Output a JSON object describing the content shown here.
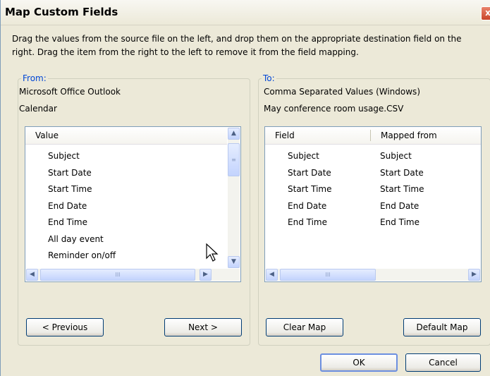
{
  "window": {
    "title": "Map Custom Fields",
    "close_label": "x"
  },
  "instructions": "Drag the values from the source file on the left, and drop them on the appropriate destination field on the right.  Drag the item from the right to the left to remove it from the field mapping.",
  "from": {
    "legend": "From:",
    "source_line1": "Microsoft Office Outlook",
    "source_line2": "Calendar",
    "list_header": "Value",
    "items": [
      "Subject",
      "Start Date",
      "Start Time",
      "End Date",
      "End Time",
      "All day event",
      "Reminder on/off"
    ],
    "previous_label": "< Previous",
    "next_label": "Next >"
  },
  "to": {
    "legend": "To:",
    "dest_line1": "Comma Separated Values (Windows)",
    "dest_line2": "May conference room usage.CSV",
    "col_field": "Field",
    "col_mapped": "Mapped from",
    "rows": [
      {
        "field": "Subject",
        "mapped": "Subject"
      },
      {
        "field": "Start Date",
        "mapped": "Start Date"
      },
      {
        "field": "Start Time",
        "mapped": "Start Time"
      },
      {
        "field": "End Date",
        "mapped": "End Date"
      },
      {
        "field": "End Time",
        "mapped": "End Time"
      }
    ],
    "clear_label": "Clear Map",
    "default_label": "Default Map"
  },
  "footer": {
    "ok_label": "OK",
    "cancel_label": "Cancel"
  },
  "icons": {
    "scroll_up": "▲",
    "scroll_down": "▼",
    "scroll_left": "◀",
    "scroll_right": "▶",
    "thumb_grip": "III",
    "thumb_grip_v": "≡"
  },
  "colors": {
    "legend": "#0046d5",
    "dialog_bg": "#ece9d8",
    "list_border": "#7f9db9"
  }
}
